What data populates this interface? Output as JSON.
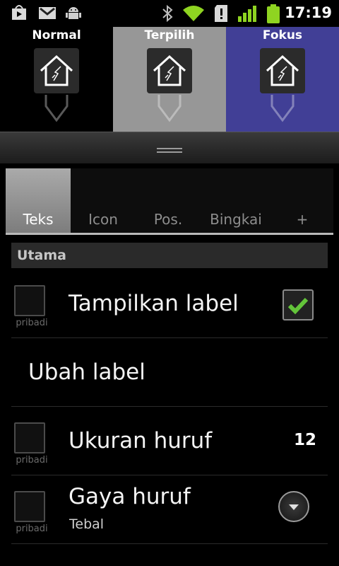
{
  "status_bar": {
    "time": "17:19",
    "icons": [
      "play-store-icon",
      "gmail-icon",
      "android-debug-icon",
      "bluetooth-icon",
      "wifi-icon",
      "sd-card-warning-icon",
      "signal-icon",
      "battery-icon"
    ],
    "colors": {
      "accent": "#8fd421"
    }
  },
  "states": [
    {
      "label": "Normal",
      "bg": "#000000"
    },
    {
      "label": "Terpilih",
      "bg": "#979797"
    },
    {
      "label": "Fokus",
      "bg": "#413f96"
    }
  ],
  "tabs": [
    {
      "label": "Teks",
      "active": true
    },
    {
      "label": "Icon",
      "active": false
    },
    {
      "label": "Pos.",
      "active": false
    },
    {
      "label": "Bingkai",
      "active": false
    },
    {
      "label": "+",
      "active": false
    }
  ],
  "section_title": "Utama",
  "rows": {
    "show_label": {
      "checkbox_label": "pribadi",
      "title": "Tampilkan label",
      "checked": true
    },
    "edit_label": {
      "title": "Ubah label"
    },
    "font_size": {
      "checkbox_label": "pribadi",
      "title": "Ukuran huruf",
      "value": "12"
    },
    "font_style": {
      "checkbox_label": "pribadi",
      "title": "Gaya huruf",
      "subtitle": "Tebal"
    }
  }
}
